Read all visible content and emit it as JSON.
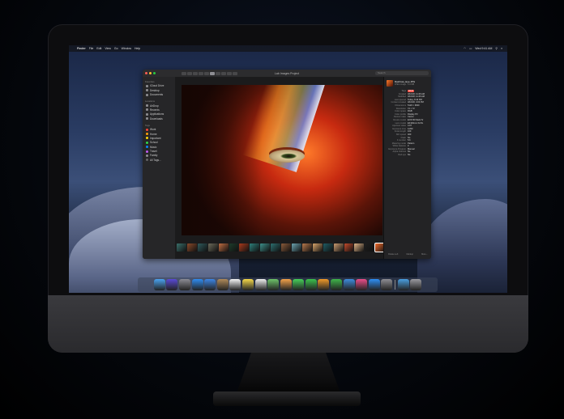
{
  "menubar": {
    "app": "Finder",
    "items": [
      "File",
      "Edit",
      "View",
      "Go",
      "Window",
      "Help"
    ],
    "clock": "Wed 9:41 AM"
  },
  "window": {
    "title": "Lab Images Project",
    "search_placeholder": "Search"
  },
  "sidebar": {
    "favorites_header": "Favorites",
    "favorites": [
      {
        "label": "iCloud Drive",
        "icon": "cloud-icon"
      },
      {
        "label": "Desktop",
        "icon": "desktop-icon"
      },
      {
        "label": "Documents",
        "icon": "document-icon"
      }
    ],
    "locations_header": "Locations",
    "locations": [
      {
        "label": "AirDrop",
        "icon": "airdrop-icon"
      },
      {
        "label": "Recents",
        "icon": "clock-icon"
      },
      {
        "label": "Applications",
        "icon": "applications-icon"
      },
      {
        "label": "Downloads",
        "icon": "download-icon"
      }
    ],
    "tags_header": "Tags",
    "tags": [
      {
        "label": "Work",
        "color": "#ff453a"
      },
      {
        "label": "Home",
        "color": "#ff9f0a"
      },
      {
        "label": "Important",
        "color": "#ffd60a"
      },
      {
        "label": "School",
        "color": "#32d74b"
      },
      {
        "label": "Music",
        "color": "#0a84ff"
      },
      {
        "label": "Travel",
        "color": "#bf5af2"
      },
      {
        "label": "Family",
        "color": "#8e8e93"
      },
      {
        "label": "All Tags...",
        "color": "#636366"
      }
    ]
  },
  "inspector": {
    "file_name": "Rainbow_Eye.JPG",
    "file_info": "JPEG image - 5.6 MB",
    "fields": [
      {
        "k": "Tags",
        "v": "Work"
      },
      {
        "k": "Created",
        "v": "3/10/18, 11:46 AM"
      },
      {
        "k": "Modified",
        "v": "3/10/18, 11:46 AM"
      },
      {
        "k": "Last opened",
        "v": "Today, 8:43 PM"
      },
      {
        "k": "Content created",
        "v": "3/10/18, 4:03 PM"
      },
      {
        "k": "Dimensions",
        "v": "5120 × 3840"
      },
      {
        "k": "Resolution",
        "v": "72 × 72"
      },
      {
        "k": "Color space",
        "v": "RGB"
      },
      {
        "k": "Color profile",
        "v": "Display P3"
      },
      {
        "k": "Device make",
        "v": "Canon"
      },
      {
        "k": "Device model",
        "v": "EOS 5D Mark IV"
      },
      {
        "k": "Lens model",
        "v": "EF100mm f/2.8L"
      },
      {
        "k": "Aperture value",
        "v": "4.97"
      },
      {
        "k": "Exposure time",
        "v": "1/200"
      },
      {
        "k": "Focal length",
        "v": "100"
      },
      {
        "k": "ISO speed",
        "v": "400"
      },
      {
        "k": "Flash",
        "v": "No"
      },
      {
        "k": "F number",
        "v": "5.6"
      },
      {
        "k": "Metering mode",
        "v": "Pattern"
      },
      {
        "k": "White balance",
        "v": "0"
      },
      {
        "k": "Exposure Program",
        "v": "Manual"
      },
      {
        "k": "Alpha channel",
        "v": "No"
      },
      {
        "k": "Red eye",
        "v": "No"
      }
    ],
    "tools": [
      "Rotate Left",
      "Markup",
      "More..."
    ]
  },
  "filmstrip_colors": [
    "#3a6f6a",
    "#8a4a2a",
    "#2f5a5c",
    "#6c6a5a",
    "#c06d42",
    "#1e3b2a",
    "#a93a1c",
    "#2e7f7a",
    "#3d8f8a",
    "#2d6f70",
    "#8a5a3a",
    "#6ca3b0",
    "#b9794c",
    "#d8a46a",
    "#1f5b63",
    "#c99b70",
    "#c24a2a",
    "#e0b487",
    "#1e1e1e",
    "#f36a2a"
  ],
  "dock_apps": [
    {
      "name": "finder-icon",
      "color": "#4aa3f0"
    },
    {
      "name": "siri-icon",
      "color": "#5a4ad6"
    },
    {
      "name": "launchpad-icon",
      "color": "#8c8c94"
    },
    {
      "name": "safari-icon",
      "color": "#2f8cf0"
    },
    {
      "name": "mail-icon",
      "color": "#3d86e5"
    },
    {
      "name": "contacts-icon",
      "color": "#b08a5a"
    },
    {
      "name": "calendar-icon",
      "color": "#f5f5f5"
    },
    {
      "name": "notes-icon",
      "color": "#f5d94a"
    },
    {
      "name": "reminders-icon",
      "color": "#efefef"
    },
    {
      "name": "maps-icon",
      "color": "#6ec36a"
    },
    {
      "name": "photos-icon",
      "color": "#f2a24a"
    },
    {
      "name": "messages-icon",
      "color": "#46d05a"
    },
    {
      "name": "facetime-icon",
      "color": "#3cc24e"
    },
    {
      "name": "pages-icon",
      "color": "#f09a2a"
    },
    {
      "name": "numbers-icon",
      "color": "#3fb54a"
    },
    {
      "name": "keynote-icon",
      "color": "#3e8cdc"
    },
    {
      "name": "itunes-icon",
      "color": "#ea4e8a"
    },
    {
      "name": "appstore-icon",
      "color": "#2e8ff5"
    },
    {
      "name": "preferences-icon",
      "color": "#8e8e93"
    },
    {
      "name": "downloads-folder-icon",
      "color": "#4a9fe0"
    },
    {
      "name": "trash-icon",
      "color": "#9a9aa0"
    }
  ]
}
